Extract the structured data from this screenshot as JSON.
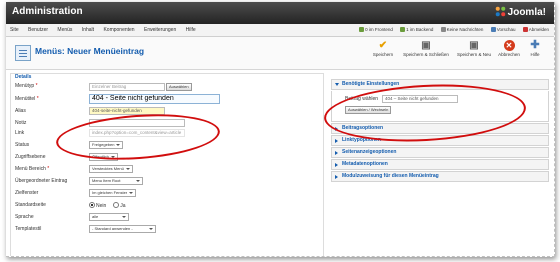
{
  "header": {
    "title": "Administration",
    "logo_text": "Joomla!"
  },
  "menubar": {
    "items": [
      "Site",
      "Benutzer",
      "Menüs",
      "Inhalt",
      "Komponenten",
      "Erweiterungen",
      "Hilfe"
    ],
    "status": [
      "0 im Frontend",
      "1 im Backend",
      "Keine Nachrichten",
      "Vorschau",
      "Abmelden"
    ]
  },
  "toolbar": {
    "title": "Menüs: Neuer Menüeintrag",
    "buttons": [
      "Speichern",
      "Speichern & Schließen",
      "Speichern & Neu",
      "Abbrechen",
      "Hilfe"
    ]
  },
  "details": {
    "legend": "Details",
    "labels": {
      "menutyp": "Menütyp",
      "menutitel": "Menütitel",
      "alias": "Alias",
      "notiz": "Notiz",
      "link": "Link",
      "status": "Status",
      "zugriff": "Zugriffsebene",
      "menubereich": "Menü Bereich",
      "uebergeordnet": "Übergeordneter Eintrag",
      "zielfenster": "Zielfenster",
      "standardseite": "Standardseite",
      "sprache": "Sprache",
      "template": "Templatestil"
    },
    "values": {
      "menutyp": "Einzelner Beitrag",
      "menutyp_button": "Auswählen",
      "menutitel": "404 - Seite nicht gefunden",
      "alias": "404-seite-nicht-gefunden",
      "notiz": "",
      "link": "index.php?option=com_content&view=article",
      "status": "Freigegeben",
      "zugriff": "Öffentlich",
      "menubereich": "Verstecktes Menü",
      "uebergeordnet": "Menu Item Root",
      "zielfenster": "Im gleichen Fenster",
      "standard_nein": "Nein",
      "standard_ja": "Ja",
      "sprache": "alle",
      "template": "- Standard anwenden -"
    }
  },
  "right_panel": {
    "required": {
      "title": "Benötigte Einstellungen",
      "label": "Beitrag wählen",
      "value": "404 – Seite nicht gefunden",
      "button": "Auswählen / Wechseln"
    },
    "panels": [
      "Beitragsoptionen",
      "Linktypoptionen",
      "Seitenanzeigeoptionen",
      "Metadatenoptionen",
      "Modulzuweisung für diesen Menüeintrag"
    ]
  },
  "colors": {
    "accent": "#135cae",
    "annotation": "#d10d0d",
    "save": "#e8a000",
    "cancel": "#d43b1c"
  }
}
